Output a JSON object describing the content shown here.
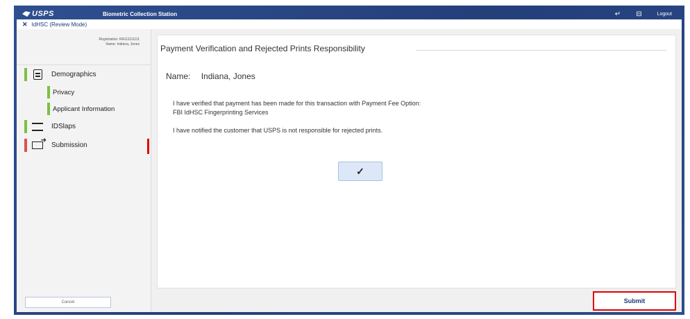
{
  "header": {
    "brand": "USPS",
    "station_title": "Biometric Collection Station",
    "logout": "Logout"
  },
  "subbar": {
    "mode_icon": "✕",
    "mode_label": "IdHSC (Review Mode)"
  },
  "sidebar": {
    "registration_line1": "Registration: RA111111111",
    "registration_line2": "Name: Indiana, Jones",
    "items": [
      {
        "label": "Demographics",
        "icon": "document-icon",
        "status": "complete"
      },
      {
        "label": "Privacy",
        "status": "complete"
      },
      {
        "label": "Applicant Information",
        "status": "complete"
      },
      {
        "label": "IDSlaps",
        "icon": "fingerprint-scanner-icon",
        "status": "complete"
      },
      {
        "label": "Submission",
        "icon": "send-icon",
        "status": "incomplete"
      }
    ],
    "cancel_label": "Cancel"
  },
  "main": {
    "panel_title": "Payment Verification and Rejected Prints Responsibility",
    "name_label": "Name:",
    "name_value": "Indiana, Jones",
    "paragraph1_line1": "I have verified that payment has been made for this transaction with Payment Fee Option:",
    "paragraph1_line2": "FBI IdHSC Fingerprinting Services",
    "paragraph2": "I have notified the customer that USPS is not responsible for rejected prints.",
    "check_button": "✓",
    "submit_label": "Submit"
  },
  "colors": {
    "frame_blue": "#2f4f8f",
    "complete_green": "#7bc043",
    "incomplete_red": "#d9534f",
    "highlight_red": "#e00000"
  }
}
